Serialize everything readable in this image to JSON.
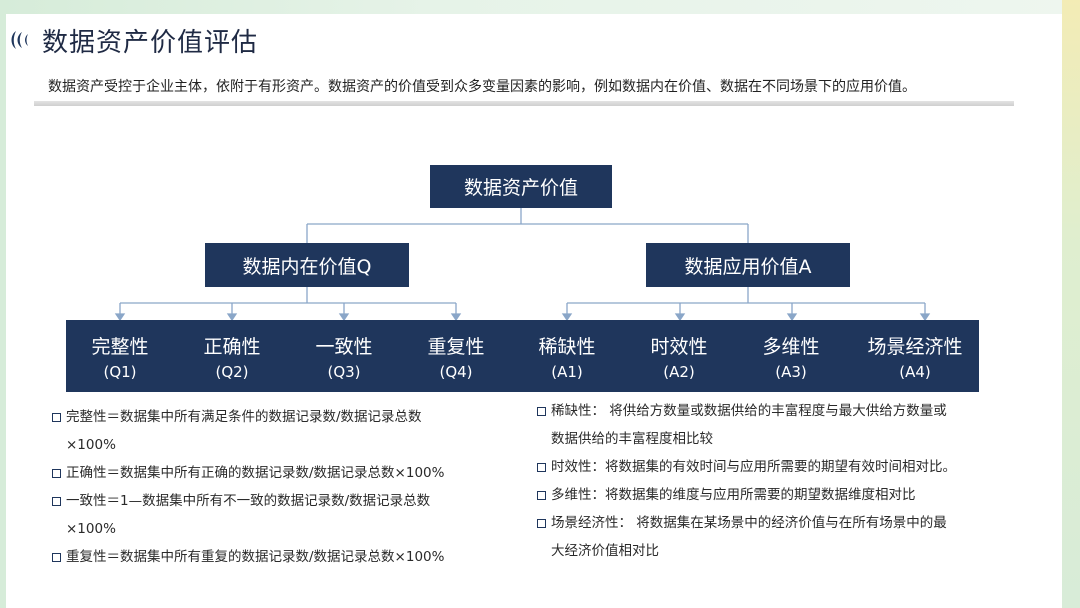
{
  "title": "数据资产价值评估",
  "subtitle": "数据资产受控于企业主体，依附于有形资产。数据资产的价值受到众多变量因素的影响，例如数据内在价值、数据在不同场景下的应用价值。",
  "tree": {
    "root": "数据资产价值",
    "left": "数据内在价值Q",
    "right": "数据应用价值A",
    "categories": [
      {
        "name": "完整性",
        "code": "(Q1)"
      },
      {
        "name": "正确性",
        "code": "(Q2)"
      },
      {
        "name": "一致性",
        "code": "(Q3)"
      },
      {
        "name": "重复性",
        "code": "(Q4)"
      },
      {
        "name": "稀缺性",
        "code": "(A1)"
      },
      {
        "name": "时效性",
        "code": "(A2)"
      },
      {
        "name": "多维性",
        "code": "(A3)"
      },
      {
        "name": "场景经济性",
        "code": "(A4)"
      }
    ]
  },
  "left_desc": [
    {
      "l1": "完整性＝数据集中所有满足条件的数据记录数/数据记录总数",
      "l2": "×100%"
    },
    {
      "l1": "正确性＝数据集中所有正确的数据记录数/数据记录总数×100%",
      "l2": ""
    },
    {
      "l1": "一致性＝1—数据集中所有不一致的数据记录数/数据记录总数",
      "l2": "×100%"
    },
    {
      "l1": "重复性＝数据集中所有重复的数据记录数/数据记录总数×100%",
      "l2": ""
    }
  ],
  "right_desc": [
    {
      "l1": "稀缺性： 将供给方数量或数据供给的丰富程度与最大供给方数量或",
      "l2": "数据供给的丰富程度相比较"
    },
    {
      "l1": "时效性：将数据集的有效时间与应用所需要的期望有效时间相对比。",
      "l2": ""
    },
    {
      "l1": "多维性：将数据集的维度与应用所需要的期望数据维度相对比",
      "l2": ""
    },
    {
      "l1": "场景经济性： 将数据集在某场景中的经济价值与在所有场景中的最",
      "l2": "大经济价值相对比"
    }
  ],
  "colors": {
    "box": "#1f365c",
    "line": "#8aa6c8"
  }
}
